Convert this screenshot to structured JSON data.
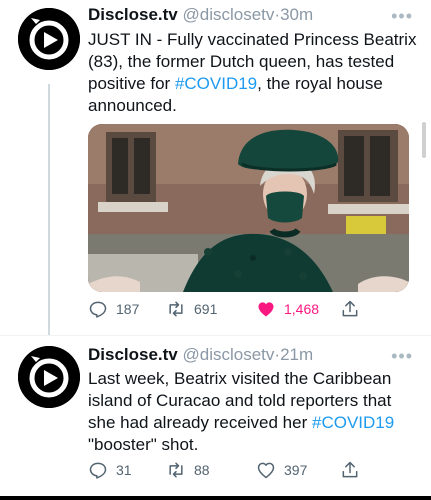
{
  "tweets": [
    {
      "display_name": "Disclose.tv",
      "handle": "@disclosetv",
      "separator": "·",
      "time": "30m",
      "text_parts": [
        "JUST IN - Fully vaccinated Princess Beatrix (83), the former Dutch queen, has tested positive for ",
        "#COVID19",
        ", the royal house announced."
      ],
      "has_media": true,
      "replies": "187",
      "retweets": "691",
      "likes": "1,468",
      "liked": true
    },
    {
      "display_name": "Disclose.tv",
      "handle": "@disclosetv",
      "separator": "·",
      "time": "21m",
      "text_parts": [
        "Last week, Beatrix visited the Caribbean island of Curacao and told reporters that she had already received her ",
        "#COVID19",
        " \"booster\" shot."
      ],
      "has_media": false,
      "replies": "31",
      "retweets": "88",
      "likes": "397",
      "liked": false
    }
  ],
  "icons": {
    "avatar": "disclosetv-play-logo-icon",
    "reply": "reply-bubble-icon",
    "retweet": "retweet-icon",
    "like": "heart-icon",
    "share": "share-icon",
    "more": "more-dots-icon"
  },
  "colors": {
    "hashtag": "#1d9bf0",
    "like_active": "#f91880",
    "handle_gray": "#8b98a5",
    "text": "#0f1419"
  }
}
